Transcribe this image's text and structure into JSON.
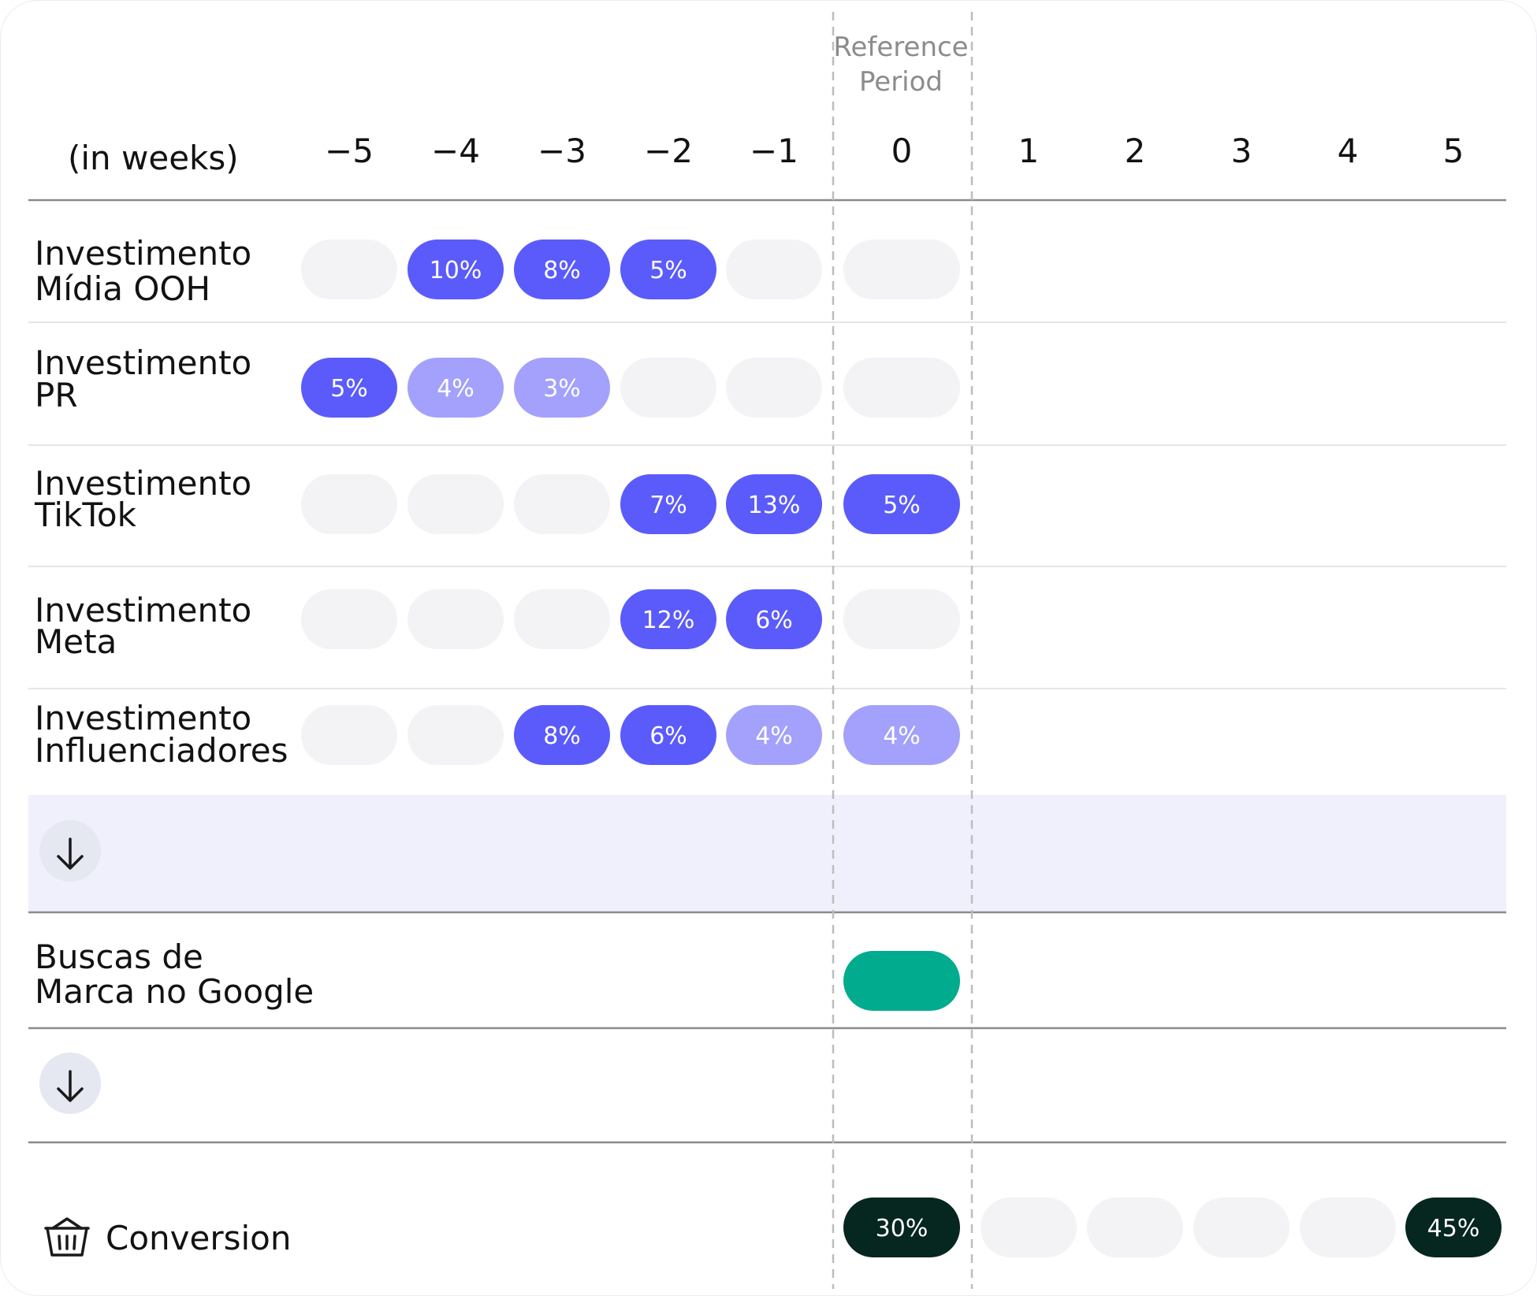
{
  "chart_data": {
    "type": "heatmap",
    "unit_label": "(in weeks)",
    "reference_label_line1": "Reference",
    "reference_label_line2": "Period",
    "weeks": [
      "−5",
      "−4",
      "−3",
      "−2",
      "−1",
      "0",
      "1",
      "2",
      "3",
      "4",
      "5"
    ],
    "reference_week": "0",
    "rows": [
      {
        "label_line1": "Investimento",
        "label_line2": "Mídia OOH",
        "values": [
          null,
          10,
          8,
          5,
          null,
          null
        ],
        "labels": [
          "",
          "10%",
          "8%",
          "5%",
          "",
          ""
        ],
        "strength": [
          "empty",
          "strong",
          "strong",
          "strong",
          "empty",
          "empty"
        ]
      },
      {
        "label_line1": "Investimento",
        "label_line2": "PR",
        "values": [
          5,
          4,
          3,
          null,
          null,
          null
        ],
        "labels": [
          "5%",
          "4%",
          "3%",
          "",
          "",
          ""
        ],
        "strength": [
          "strong",
          "weak",
          "weak",
          "empty",
          "empty",
          "empty"
        ]
      },
      {
        "label_line1": "Investimento",
        "label_line2": "TikTok",
        "values": [
          null,
          null,
          null,
          7,
          13,
          5
        ],
        "labels": [
          "",
          "",
          "",
          "7%",
          "13%",
          "5%"
        ],
        "strength": [
          "empty",
          "empty",
          "empty",
          "strong",
          "strong",
          "strong"
        ]
      },
      {
        "label_line1": "Investimento",
        "label_line2": "Meta",
        "values": [
          null,
          null,
          null,
          12,
          6,
          null
        ],
        "labels": [
          "",
          "",
          "",
          "12%",
          "6%",
          ""
        ],
        "strength": [
          "empty",
          "empty",
          "empty",
          "strong",
          "strong",
          "empty"
        ]
      },
      {
        "label_line1": "Investimento",
        "label_line2": "Influenciadores",
        "values": [
          null,
          null,
          8,
          6,
          4,
          4
        ],
        "labels": [
          "",
          "",
          "8%",
          "6%",
          "4%",
          "4%"
        ],
        "strength": [
          "empty",
          "empty",
          "strong",
          "strong",
          "weak",
          "weak"
        ]
      }
    ],
    "intermediate": {
      "label_line1": "Buscas de",
      "label_line2": "Marca no Google",
      "week": "0"
    },
    "outcome": {
      "label": "Conversion",
      "icon": "basket-icon",
      "weeks": [
        "0",
        "1",
        "2",
        "3",
        "4",
        "5"
      ],
      "values": [
        30,
        null,
        null,
        null,
        null,
        45
      ],
      "labels": [
        "30%",
        "",
        "",
        "",
        "",
        "45%"
      ]
    },
    "colors": {
      "strong": "#5b5bfb",
      "weak": "#a3a1fb",
      "empty": "#f3f3f6",
      "intermediate": "#00ab8e",
      "outcome": "#062620",
      "highlight_band": "#f0f0fd",
      "arrow_circle": "#e5e7f1"
    },
    "arrow_icon": "arrow-down-icon"
  }
}
